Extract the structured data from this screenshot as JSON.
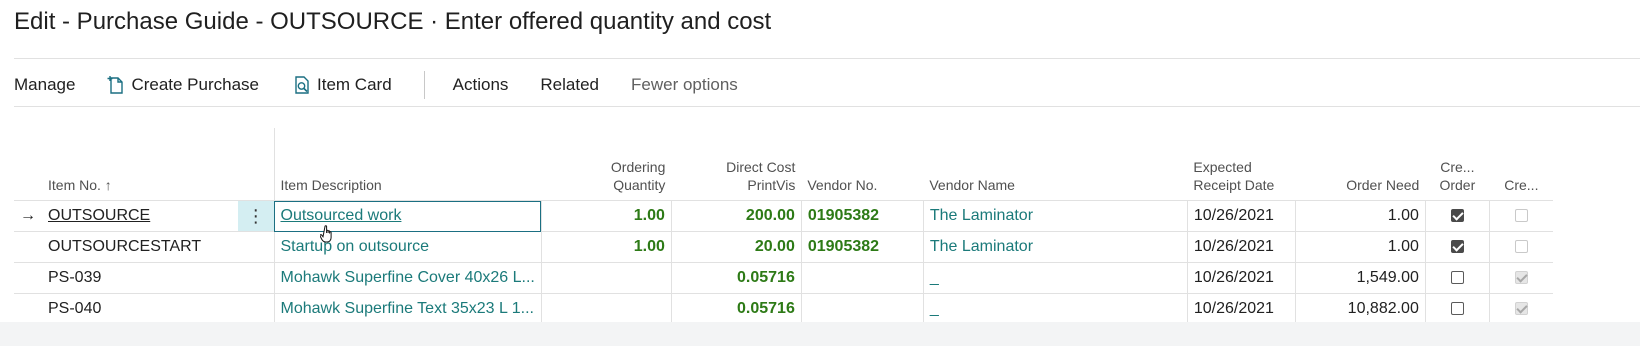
{
  "page": {
    "title": "Edit - Purchase Guide - OUTSOURCE · Enter offered quantity and cost"
  },
  "toolbar": {
    "manage": "Manage",
    "create_purchase": "Create Purchase",
    "item_card": "Item Card",
    "actions": "Actions",
    "related": "Related",
    "fewer_options": "Fewer options"
  },
  "columns": {
    "item_no": "Item No.",
    "sort_indicator": "↑",
    "item_description": "Item Description",
    "ordering_quantity_1": "Ordering",
    "ordering_quantity_2": "Quantity",
    "direct_cost_1": "Direct Cost",
    "direct_cost_2": "PrintVis",
    "vendor_no": "Vendor No.",
    "vendor_name": "Vendor Name",
    "expected_receipt_1": "Expected",
    "expected_receipt_2": "Receipt Date",
    "order_need": "Order Need",
    "create_order_1": "Cre...",
    "create_order_2": "Order",
    "create_2": "Cre..."
  },
  "rows": [
    {
      "current": true,
      "arrow": "→",
      "item_no": "OUTSOURCE",
      "actions_menu": "⋮",
      "description": "Outsourced work",
      "ordering_quantity": "1.00",
      "direct_cost": "200.00",
      "vendor_no": "01905382",
      "vendor_name": "The Laminator",
      "expected_receipt_date": "10/26/2021",
      "order_need": "1.00",
      "create_order": true,
      "create_other": false
    },
    {
      "current": false,
      "arrow": "",
      "item_no": "OUTSOURCESTART",
      "actions_menu": "",
      "description": "Startup on outsource",
      "ordering_quantity": "1.00",
      "direct_cost": "20.00",
      "vendor_no": "01905382",
      "vendor_name": "The Laminator",
      "expected_receipt_date": "10/26/2021",
      "order_need": "1.00",
      "create_order": true,
      "create_other": false
    },
    {
      "current": false,
      "arrow": "",
      "item_no": "PS-039",
      "actions_menu": "",
      "description": "Mohawk Superfine Cover 40x26 L...",
      "ordering_quantity": "",
      "direct_cost": "0.05716",
      "vendor_no": "",
      "vendor_name": "_",
      "expected_receipt_date": "10/26/2021",
      "order_need": "1,549.00",
      "create_order": false,
      "create_other": true
    },
    {
      "current": false,
      "arrow": "",
      "item_no": "PS-040",
      "actions_menu": "",
      "description": "Mohawk Superfine Text 35x23 L 1...",
      "ordering_quantity": "",
      "direct_cost": "0.05716",
      "vendor_no": "",
      "vendor_name": "_",
      "expected_receipt_date": "10/26/2021",
      "order_need": "10,882.00",
      "create_order": false,
      "create_other": true
    }
  ],
  "icons": {
    "create_purchase": "document-new-icon",
    "item_card": "document-search-icon",
    "cursor": "hand-pointer-icon"
  },
  "colors": {
    "link_teal": "#1b7a7a",
    "value_green": "#2d7a16",
    "selection_bg": "#d4eef2"
  }
}
